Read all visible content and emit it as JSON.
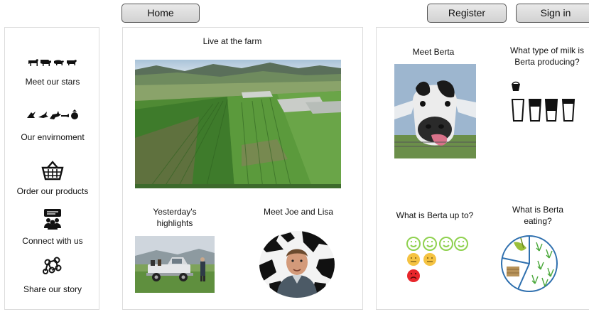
{
  "header": {
    "home_label": "Home",
    "register_label": "Register",
    "signin_label": "Sign in"
  },
  "sidebar": {
    "items": [
      {
        "label": "Meet our stars",
        "icon": "farm-animals-icon"
      },
      {
        "label": "Our envirnoment",
        "icon": "wildlife-icon"
      },
      {
        "label": "Order our products",
        "icon": "shopping-basket-icon"
      },
      {
        "label": "Connect with us",
        "icon": "group-chat-icon"
      },
      {
        "label": "Share our story",
        "icon": "share-network-icon"
      }
    ]
  },
  "main": {
    "live_title": "Live at the farm",
    "highlights_title": "Yesterday's highlights",
    "joe_lisa_title": "Meet Joe and Lisa"
  },
  "berta": {
    "meet_title": "Meet Berta",
    "milk_question": "What type of milk is Berta producing?",
    "mood_question": "What is Berta up to?",
    "eating_question": "What is Berta eating?"
  },
  "colors": {
    "happy": "#8fd14f",
    "neutral": "#f5c342",
    "sad": "#e8262b"
  }
}
